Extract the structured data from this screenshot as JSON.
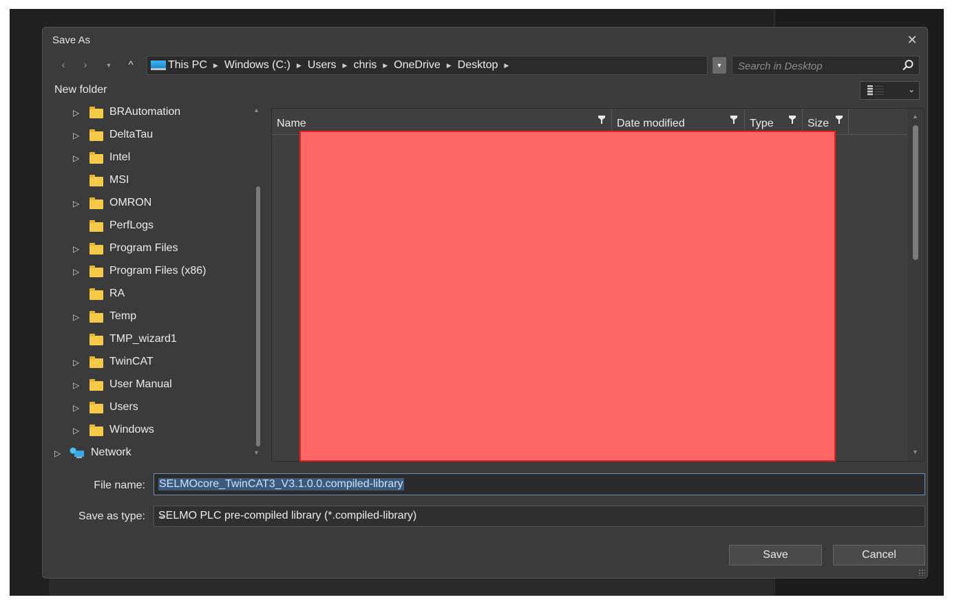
{
  "dialog": {
    "title": "Save As"
  },
  "address": {
    "breadcrumbs": [
      "This PC",
      "Windows (C:)",
      "Users",
      "chris",
      "OneDrive",
      "Desktop"
    ]
  },
  "search": {
    "placeholder": "Search in Desktop"
  },
  "toolbar": {
    "new_folder": "New folder"
  },
  "tree": {
    "items": [
      {
        "label": "BRAutomation",
        "expandable": true
      },
      {
        "label": "DeltaTau",
        "expandable": true
      },
      {
        "label": "Intel",
        "expandable": true
      },
      {
        "label": "MSI",
        "expandable": false
      },
      {
        "label": "OMRON",
        "expandable": true
      },
      {
        "label": "PerfLogs",
        "expandable": false
      },
      {
        "label": "Program Files",
        "expandable": true
      },
      {
        "label": "Program Files (x86)",
        "expandable": true
      },
      {
        "label": "RA",
        "expandable": false
      },
      {
        "label": "Temp",
        "expandable": true
      },
      {
        "label": "TMP_wizard1",
        "expandable": false
      },
      {
        "label": "TwinCAT",
        "expandable": true
      },
      {
        "label": "User Manual",
        "expandable": true
      },
      {
        "label": "Users",
        "expandable": true
      },
      {
        "label": "Windows",
        "expandable": true
      }
    ],
    "network": "Network"
  },
  "columns": {
    "name": "Name",
    "date_modified": "Date modified",
    "type": "Type",
    "size": "Size"
  },
  "form": {
    "file_name_label": "File name:",
    "file_name_value": "SELMOcore_TwinCAT3_V3.1.0.0.compiled-library",
    "save_type_label": "Save as type:",
    "save_type_value": "SELMO PLC pre-compiled library (*.compiled-library)"
  },
  "buttons": {
    "save": "Save",
    "cancel": "Cancel"
  },
  "colors": {
    "folder": "#f7c948",
    "redaction": "#ff6666",
    "dialog_bg": "#3b3b3b"
  }
}
